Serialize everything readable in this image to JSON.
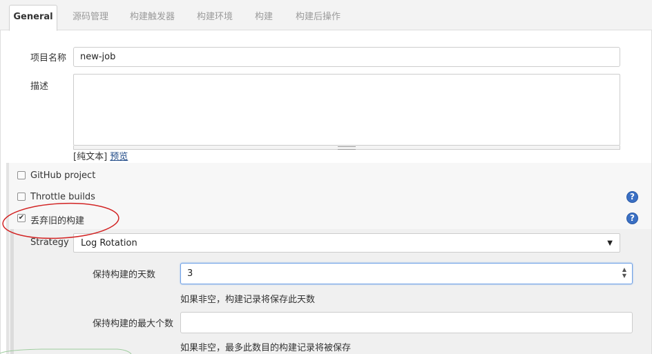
{
  "tabs": [
    {
      "label": "General",
      "active": true
    },
    {
      "label": "源码管理"
    },
    {
      "label": "构建触发器"
    },
    {
      "label": "构建环境"
    },
    {
      "label": "构建"
    },
    {
      "label": "构建后操作"
    }
  ],
  "project_name": {
    "label": "项目名称",
    "value": "new-job"
  },
  "description": {
    "label": "描述",
    "value": ""
  },
  "format": {
    "prefix": "[纯文本]",
    "preview": "预览"
  },
  "options": {
    "github_project": {
      "label": "GitHub project",
      "checked": false
    },
    "throttle_builds": {
      "label": "Throttle builds",
      "checked": false
    },
    "discard_old_builds": {
      "label": "丢弃旧的构建",
      "checked": true
    }
  },
  "strategy": {
    "label": "Strategy",
    "value": "Log Rotation"
  },
  "days_to_keep": {
    "label": "保持构建的天数",
    "value": "3",
    "hint": "如果非空，构建记录将保存此天数"
  },
  "max_builds": {
    "label": "保持构建的最大个数",
    "value": "",
    "hint": "如果非空，最多此数目的构建记录将被保存"
  },
  "help_glyph": "?",
  "check_glyph": "✔",
  "dropdown_glyph": "▼",
  "spinner_glyphs": {
    "up": "▲",
    "down": "▼"
  },
  "colors": {
    "accent": "#3b70c4",
    "link": "#204a87",
    "focus": "#6fa1e6",
    "annotation": "#d22222"
  }
}
